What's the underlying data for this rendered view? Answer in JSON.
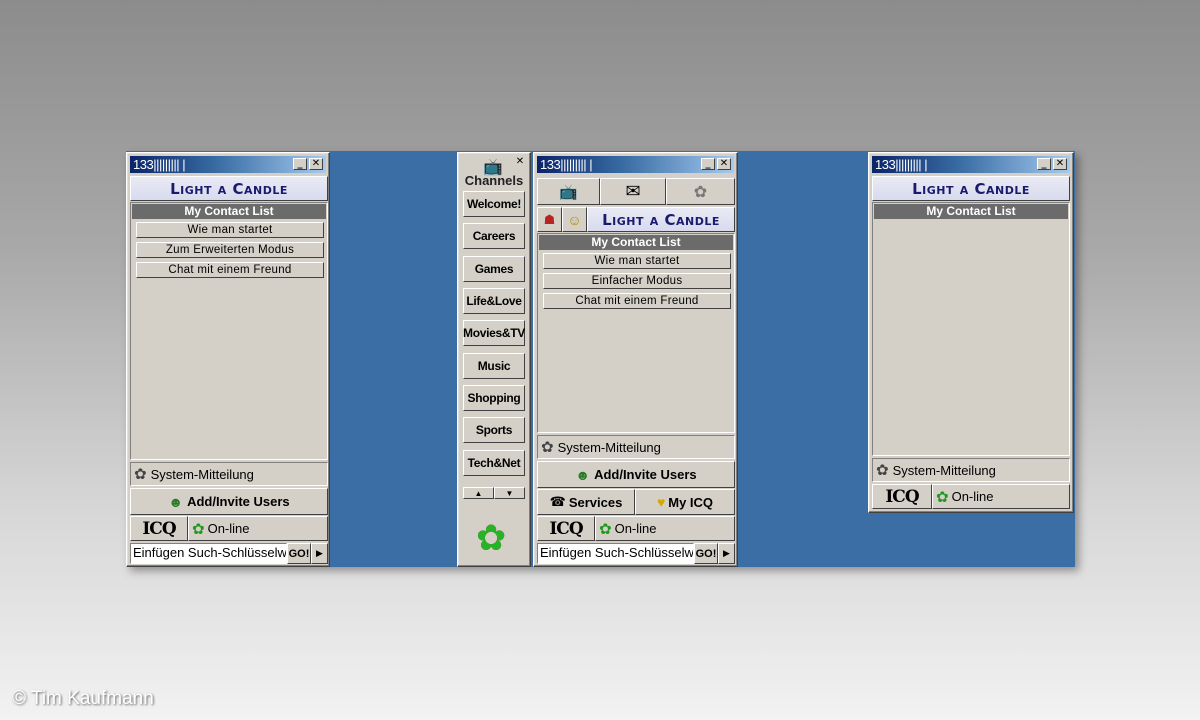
{
  "credit": "© Tim Kaufmann",
  "icons": {
    "minimize": "minimize-icon",
    "close": "close-icon",
    "flower": "icq-flower-icon"
  },
  "colors": {
    "desktop": "#3a6ea5",
    "titlebar": "#0a246a",
    "window": "#d4d0c8"
  },
  "win1": {
    "title": "133||||||||| |",
    "banner": "Light a Candle",
    "group": "My Contact List",
    "items": [
      "Wie man startet",
      "Zum Erweiterten Modus",
      "Chat mit einem Freund"
    ],
    "system": "System-Mitteilung",
    "add": "Add/Invite Users",
    "logo": "ICQ",
    "status": "On-line",
    "search": "Einfügen Such-Schlüsselw",
    "go": "GO!"
  },
  "channels": {
    "title": "Channels",
    "items": [
      "Welcome!",
      "Careers",
      "Games",
      "Life&Love",
      "Movies&TV",
      "Music",
      "Shopping",
      "Sports",
      "Tech&Net"
    ]
  },
  "win2": {
    "title": "133||||||||| |",
    "banner": "Light a Candle",
    "group": "My Contact List",
    "items": [
      "Wie man startet",
      "Einfacher Modus",
      "Chat mit einem Freund"
    ],
    "system": "System-Mitteilung",
    "add": "Add/Invite Users",
    "services": "Services",
    "myicq": "My ICQ",
    "logo": "ICQ",
    "status": "On-line",
    "search": "Einfügen Such-Schlüsselw",
    "go": "GO!"
  },
  "win3": {
    "title": "133||||||||| |",
    "banner": "Light a Candle",
    "group": "My Contact List",
    "system": "System-Mitteilung",
    "logo": "ICQ",
    "status": "On-line"
  }
}
